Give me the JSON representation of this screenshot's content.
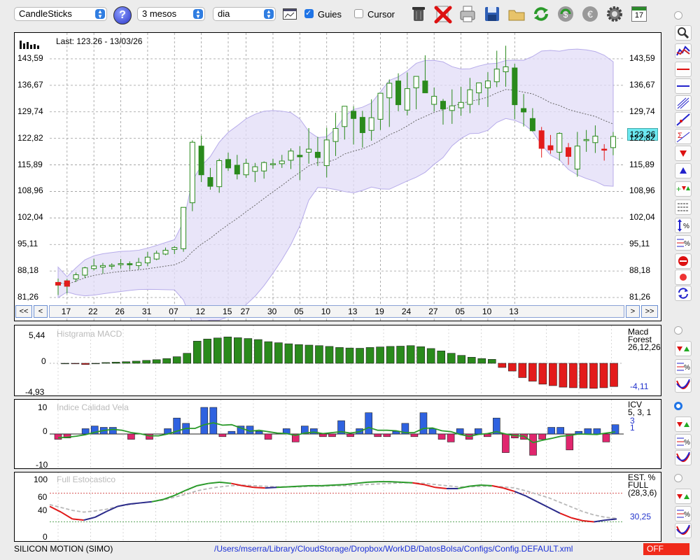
{
  "toolbar": {
    "chart_type": "CandleSticks",
    "period": "3 mesos",
    "interval": "dia",
    "guides_label": "Guies",
    "guides_checked": true,
    "cursor_label": "Cursor",
    "cursor_checked": false,
    "calendar_day": "17"
  },
  "main": {
    "last_label": "Last: 123.26 - 13/03/26",
    "last_price": "123,26",
    "price_ticks": [
      "143,59",
      "136,67",
      "129,74",
      "122,82",
      "115,89",
      "108,96",
      "102,04",
      "95,11",
      "88,18",
      "81,26"
    ],
    "date_ticks": [
      "17",
      "22",
      "26",
      "31",
      "07",
      "12",
      "15",
      "27",
      "30",
      "05",
      "10",
      "13",
      "19",
      "24",
      "27",
      "05",
      "10",
      "13"
    ],
    "nav": {
      "first": "<<",
      "prev": "<",
      "next": ">",
      "last": ">>"
    }
  },
  "macd": {
    "title": "Histgrama MACD",
    "ticks": [
      "5,44",
      "0",
      "-4,93"
    ],
    "name": "Macd",
    "sub": "Forest",
    "params": "26,12,26",
    "value": "-4,11"
  },
  "icv": {
    "title": "Indice Calidad Vela",
    "ticks": [
      "10",
      "0",
      "-10"
    ],
    "name": "ICV",
    "params": "5, 3, 1",
    "value_1": "3",
    "value_2": "1"
  },
  "stoch": {
    "title": "Full Estocastico",
    "ticks": [
      "100",
      "60",
      "40",
      "0"
    ],
    "name": "EST. %",
    "sub": "FULL",
    "params": "(28,3,6)",
    "value": "30,25"
  },
  "status": {
    "symbol": "SILICON MOTION (SIMO)",
    "path": "/Users/mserra/Library/CloudStorage/Dropbox/WorkDB/DatosBolsa/Configs/Config.DEFAULT.xml",
    "state": "OFF"
  },
  "colors": {
    "up": "#2a8a1c",
    "down": "#e31b1b",
    "band": "#e2dcf7",
    "accent": "#1f74e6",
    "icv_up": "#2f62e0",
    "icv_down": "#e0266e"
  },
  "chart_data": [
    {
      "type": "candlestick",
      "title": "Last: 123.26 - 13/03/26",
      "ylim": [
        81.26,
        147.0
      ],
      "x": [
        "17",
        "22",
        "26",
        "31",
        "07",
        "12",
        "15",
        "27",
        "30",
        "05",
        "10",
        "13",
        "19",
        "24",
        "27",
        "05",
        "10",
        "13"
      ],
      "ohlc": [
        [
          84.5,
          86.2,
          81.9,
          85.2
        ],
        [
          85.6,
          86.1,
          82.3,
          84.2
        ],
        [
          86.1,
          87.8,
          85.3,
          87.2
        ],
        [
          87.1,
          89.3,
          86.3,
          89.0
        ],
        [
          88.8,
          91.4,
          88.3,
          89.5
        ],
        [
          89.2,
          90.3,
          87.5,
          89.6
        ],
        [
          89.6,
          90.2,
          88.6,
          89.7
        ],
        [
          89.9,
          91.3,
          88.8,
          90.1
        ],
        [
          90.1,
          90.7,
          88.5,
          89.8
        ],
        [
          89.6,
          91.6,
          88.6,
          90.4
        ],
        [
          90.3,
          93.2,
          89.4,
          91.8
        ],
        [
          91.3,
          93.5,
          91.0,
          92.8
        ],
        [
          92.6,
          94.3,
          92.3,
          93.6
        ],
        [
          93.8,
          94.7,
          92.6,
          94.3
        ],
        [
          94.0,
          103.5,
          93.2,
          104.8
        ],
        [
          106.0,
          122.3,
          103.8,
          121.8
        ],
        [
          120.8,
          123.5,
          111.4,
          113.3
        ],
        [
          112.6,
          115.1,
          109.4,
          110.3
        ],
        [
          110.2,
          117.5,
          108.6,
          117.0
        ],
        [
          117.3,
          119.1,
          114.3,
          115.1
        ],
        [
          115.8,
          118.5,
          112.1,
          113.5
        ],
        [
          113.3,
          117.5,
          112.5,
          116.3
        ],
        [
          114.2,
          116.4,
          111.4,
          115.4
        ],
        [
          114.3,
          116.8,
          112.3,
          116.5
        ],
        [
          116.0,
          117.5,
          114.9,
          116.2
        ],
        [
          116.2,
          118.5,
          115.1,
          116.9
        ],
        [
          117.1,
          120.2,
          114.8,
          119.5
        ],
        [
          118.4,
          120.8,
          111.9,
          118.0
        ],
        [
          119.2,
          125.5,
          116.2,
          120.0
        ],
        [
          119.2,
          123.2,
          115.6,
          117.8
        ],
        [
          115.7,
          125.6,
          112.6,
          122.4
        ],
        [
          122.0,
          129.5,
          118.2,
          125.4
        ],
        [
          125.9,
          130.2,
          122.5,
          131.2
        ],
        [
          129.9,
          131.2,
          121.2,
          128.0
        ],
        [
          128.3,
          130.0,
          120.4,
          124.3
        ],
        [
          124.9,
          133.0,
          122.2,
          128.2
        ],
        [
          127.8,
          133.6,
          125.0,
          134.6
        ],
        [
          133.4,
          138.2,
          125.8,
          137.2
        ],
        [
          137.8,
          139.8,
          129.9,
          131.6
        ],
        [
          130.2,
          140.0,
          128.8,
          135.8
        ],
        [
          136.0,
          138.0,
          130.4,
          139.0
        ],
        [
          137.8,
          144.5,
          136.2,
          134.7
        ],
        [
          131.7,
          136.1,
          129.8,
          133.8
        ],
        [
          132.5,
          133.1,
          126.4,
          130.5
        ],
        [
          130.1,
          135.6,
          126.6,
          131.3
        ],
        [
          130.8,
          136.3,
          128.7,
          132.2
        ],
        [
          131.7,
          138.6,
          129.4,
          135.5
        ],
        [
          134.7,
          137.4,
          131.5,
          137.3
        ],
        [
          136.0,
          140.1,
          131.0,
          137.8
        ],
        [
          137.6,
          145.7,
          136.2,
          140.9
        ],
        [
          140.2,
          147.0,
          136.3,
          141.5
        ],
        [
          141.2,
          142.3,
          127.8,
          131.6
        ],
        [
          130.6,
          134.4,
          125.9,
          129.7
        ],
        [
          128.0,
          130.7,
          124.6,
          124.8
        ],
        [
          124.8,
          125.8,
          117.8,
          120.2
        ],
        [
          120.9,
          123.7,
          118.8,
          119.8
        ],
        [
          119.2,
          124.4,
          117.0,
          124.1
        ],
        [
          120.4,
          121.6,
          115.9,
          118.1
        ],
        [
          114.8,
          124.5,
          112.8,
          120.8
        ],
        [
          122.3,
          125.0,
          119.3,
          122.5
        ],
        [
          121.7,
          126.2,
          119.0,
          123.4
        ],
        [
          120.0,
          121.3,
          117.0,
          119.9
        ],
        [
          120.4,
          124.5,
          118.4,
          123.3
        ]
      ],
      "bollinger_band": true,
      "moving_average": true
    },
    {
      "type": "bar",
      "title": "Histgrama MACD",
      "ylim": [
        -4.93,
        5.44
      ],
      "values": [
        0,
        -0.05,
        -0.2,
        0,
        0.14,
        0.22,
        0.3,
        0.41,
        0.55,
        0.69,
        0.9,
        1.25,
        1.9,
        4.2,
        4.6,
        4.8,
        5.0,
        4.85,
        4.7,
        4.5,
        4.1,
        3.9,
        3.7,
        3.55,
        3.45,
        3.35,
        3.2,
        3.0,
        2.9,
        2.85,
        3.0,
        3.1,
        3.2,
        3.25,
        3.35,
        3.15,
        2.8,
        2.35,
        1.9,
        1.5,
        1.15,
        0.9,
        0.75,
        -0.7,
        -1.3,
        -2.4,
        -3.0,
        -3.5,
        -3.75,
        -4.0,
        -4.1,
        -4.15,
        -4.2,
        -4.1,
        -3.9
      ]
    },
    {
      "type": "bar",
      "title": "Indice Calidad Vela",
      "ylim": [
        -10,
        10
      ],
      "values": [
        -2,
        -1.5,
        0,
        2,
        3,
        2.5,
        2.5,
        0,
        -2,
        0,
        -2,
        0,
        2,
        6,
        4,
        0,
        10,
        10,
        -1,
        1,
        3,
        3,
        1,
        -2,
        0,
        2,
        -3,
        3,
        2,
        -1,
        -1,
        5,
        -1,
        2,
        8,
        -1,
        -1,
        1,
        4,
        -1,
        8,
        2,
        -2,
        -3,
        2,
        -2,
        2,
        -1,
        6,
        -7,
        -1.5,
        -2,
        -8,
        -2,
        2.5,
        2.5,
        -6,
        1,
        2,
        2,
        -3,
        3.5
      ],
      "line": "smoothed ICV"
    },
    {
      "type": "line",
      "title": "Full Estocastico",
      "ylim": [
        0,
        100
      ],
      "series": [
        {
          "name": "FULL",
          "values": [
            52,
            42,
            30,
            28,
            33,
            43,
            52,
            56,
            58,
            60,
            64,
            71,
            80,
            88,
            92,
            94,
            92,
            88,
            85,
            84,
            85,
            86,
            87,
            88,
            88,
            89,
            90,
            92,
            94,
            95,
            95,
            94,
            93,
            90,
            85,
            83,
            83,
            87,
            89,
            88,
            84,
            78,
            70,
            60,
            50,
            40,
            32,
            27,
            25,
            28,
            30
          ]
        },
        {
          "name": "signal",
          "values": [
            55,
            50,
            45,
            42,
            44,
            47,
            52,
            55,
            58,
            60,
            63,
            68,
            73,
            79,
            83,
            86,
            88,
            89,
            88,
            87,
            86,
            86,
            86,
            87,
            87,
            88,
            88,
            89,
            90,
            91,
            92,
            93,
            93,
            92,
            90,
            88,
            86,
            86,
            87,
            87,
            86,
            84,
            79,
            73,
            67,
            59,
            51,
            43,
            37,
            33,
            31
          ]
        }
      ]
    }
  ]
}
